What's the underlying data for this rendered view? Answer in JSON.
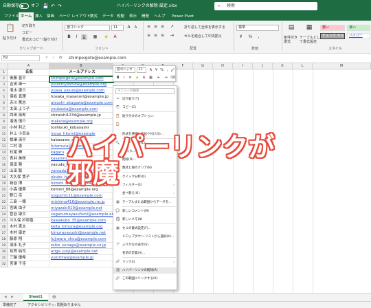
{
  "titlebar": {
    "autosave": "自動保存",
    "autosave_state": "オフ",
    "title": "ハイパーリンクの解除-設定.xlsx",
    "search_placeholder": "検索"
  },
  "tabs": [
    "ファイル",
    "ホーム",
    "挿入",
    "描画",
    "ページ レイアウト",
    "数式",
    "データ",
    "校閲",
    "表示",
    "開発",
    "ヘルプ",
    "Power Pivot"
  ],
  "active_tab": "ホーム",
  "ribbon": {
    "paste": "貼り付け",
    "cut": "切り取り",
    "copy": "コピー",
    "format_painter": "書式のコピー/貼り付け",
    "clipboard": "クリップボード",
    "font_name": "游ゴシック",
    "font_size": "11",
    "font": "フォント",
    "wrap_text": "折り返して全体を表示する",
    "merge": "セルを結合して中央揃え",
    "alignment": "配置",
    "number_format": "標準",
    "number": "数値",
    "conditional": "条件付き書式",
    "table_format": "テーブルとして書式設定",
    "style_bad": "悪い",
    "style_good": "良い",
    "style_check": "チェック セル",
    "style_link": "ハイパー",
    "styles": "スタイル",
    "bold": "B",
    "italic": "I",
    "underline": "U",
    "currency": "%",
    "comma": ","
  },
  "formula_bar": {
    "name_box": "B2",
    "fx": "fx",
    "value": "shimpeigoto@example.com"
  },
  "columns": [
    "A",
    "B",
    "C",
    "D",
    "E",
    "F",
    "G",
    "H",
    "I",
    "J",
    "K",
    "L",
    "M"
  ],
  "header_row": {
    "row": "1",
    "name": "氏名",
    "email": "メールアドレス"
  },
  "rows": [
    {
      "n": "2",
      "name": "後藤 晋平",
      "email": "shimpeigoto@example.com",
      "link": true
    },
    {
      "n": "3",
      "name": "吉田 雄一",
      "email": "yuuichiyoshida@example.org",
      "link": true
    },
    {
      "n": "4",
      "name": "清水 康介",
      "email": "yuasa_yasuo@example.com",
      "link": true
    },
    {
      "n": "5",
      "name": "保坂 真理",
      "email": "hosaka_masanori@example.jp",
      "link": false
    },
    {
      "n": "6",
      "name": "赤川 篤志",
      "email": "atsushi_akagawa@example.com",
      "link": true
    },
    {
      "n": "7",
      "name": "太田 よう子",
      "email": "youkoota@example.com",
      "link": true
    },
    {
      "n": "8",
      "name": "西田 拓郎",
      "email": "shiraishi1234@example.jp",
      "link": false
    },
    {
      "n": "9",
      "name": "湯浅 慎介",
      "email": "makuta@example.org",
      "link": true
    },
    {
      "n": "10",
      "name": "小林 利之",
      "email": "toshiyuki_kobayashi",
      "link": false
    },
    {
      "n": "11",
      "name": "井上 小百合",
      "email": "inoue_hitomi@example",
      "link": true
    },
    {
      "n": "12",
      "name": "相澤 清平",
      "email": "kabasawa_seiichi",
      "link": false
    },
    {
      "n": "13",
      "name": "二村 恵",
      "email": "futamura@example",
      "link": true
    },
    {
      "n": "14",
      "name": "杉尾 輝",
      "email": "kagaru",
      "link": true
    },
    {
      "n": "15",
      "name": "青井 美咲",
      "email": "kasahiro",
      "link": true
    },
    {
      "n": "16",
      "name": "保田 賢",
      "email": "yasuda_k",
      "link": false
    },
    {
      "n": "17",
      "name": "山田 聡",
      "email": "yamada1022@example.org",
      "link": true
    },
    {
      "n": "18",
      "name": "大久保 貴子",
      "email": "okubo_hideko@example.com",
      "link": true
    },
    {
      "n": "19",
      "name": "新谷 博",
      "email": "hiroshi_shintani@example.com",
      "link": true
    },
    {
      "n": "20",
      "name": "小森 優実",
      "email": "komori_88@example.org",
      "link": false
    },
    {
      "n": "21",
      "name": "野口 宗",
      "email": "noguchi111@example.com",
      "link": true
    },
    {
      "n": "22",
      "name": "三島 一穂",
      "email": "mishima416@example.ne.jp",
      "link": true
    },
    {
      "n": "23",
      "name": "宮嶋 由子",
      "email": "miyazaki919@example.net",
      "link": true
    },
    {
      "n": "24",
      "name": "菅谷 康文",
      "email": "suganumayasufumi@example.org",
      "link": true
    },
    {
      "n": "25",
      "name": "川久保 紗耶香",
      "email": "kawakubo_35@example.com",
      "link": true
    },
    {
      "n": "26",
      "name": "木村 恵太",
      "email": "keita_kimura@example.org",
      "link": true
    },
    {
      "n": "27",
      "name": "木村 康史",
      "email": "kimurayasushi@example.net",
      "link": true
    },
    {
      "n": "28",
      "name": "藤原 翔",
      "email": "fujiwara_shou@example.com",
      "link": true
    },
    {
      "n": "29",
      "name": "須永 礼子",
      "email": "reiko_sunaga@example.co.jp",
      "link": true
    },
    {
      "n": "30",
      "name": "有賀 純司",
      "email": "ariga_junji@example.net",
      "link": true
    },
    {
      "n": "31",
      "name": "三輪 優希",
      "email": "yukimiwa@example.jp",
      "link": true
    },
    {
      "n": "32",
      "name": "宮澤 千佳",
      "email": "",
      "link": false
    }
  ],
  "mini_toolbar": {
    "font": "游ゴシック",
    "size": "11",
    "bold": "B",
    "italic": "I",
    "percent": "%",
    "comma": ","
  },
  "context_menu": {
    "search_placeholder": "メニューの検索",
    "items": [
      {
        "label": "切り取り(T)",
        "icon": "✂",
        "arrow": false
      },
      {
        "label": "コピー(C)",
        "icon": "⎘",
        "arrow": false
      },
      {
        "label": "貼り付けのオプション:",
        "icon": "📋",
        "arrow": false
      },
      {
        "label": "",
        "icon": "📋",
        "arrow": false
      },
      {
        "label": "形式を選択して貼り付け(S)...",
        "icon": "",
        "arrow": false
      },
      {
        "label": "スマート検索(L)",
        "icon": "🔍",
        "arrow": false
      },
      {
        "label": "挿入(I)...",
        "icon": "",
        "arrow": false
      },
      {
        "label": "削除(D)...",
        "icon": "",
        "arrow": false
      },
      {
        "label": "数式と値のクリア(N)",
        "icon": "",
        "arrow": false
      },
      {
        "label": "クイック分析(Q)",
        "icon": "⚡",
        "arrow": false
      },
      {
        "label": "フィルター(E)",
        "icon": "",
        "arrow": true
      },
      {
        "label": "並べ替え(O)",
        "icon": "",
        "arrow": true
      },
      {
        "label": "テーブルまたは範囲からデータを...",
        "icon": "▦",
        "arrow": false
      },
      {
        "label": "新しいコメント(M)",
        "icon": "💬",
        "arrow": false
      },
      {
        "label": "新しいメモ(N)",
        "icon": "🗒",
        "arrow": false
      },
      {
        "label": "セルの書式設定(F)...",
        "icon": "▦",
        "arrow": false
      },
      {
        "label": "ドロップダウン リストから選択(K)...",
        "icon": "",
        "arrow": false
      },
      {
        "label": "ふりがなの表示(S)",
        "icon": "ア",
        "arrow": false
      },
      {
        "label": "名前の定義(A)...",
        "icon": "",
        "arrow": false
      },
      {
        "label": "リンク(I)",
        "icon": "🔗",
        "arrow": true
      },
      {
        "label": "ハイパーリンクの削除(R)",
        "icon": "⛓",
        "arrow": false
      },
      {
        "label": "この範囲にリンクする(K)",
        "icon": "🔗",
        "arrow": false
      }
    ]
  },
  "overlay": {
    "line1": "ハイパーリンクが",
    "line2": "邪魔",
    "color": "#e84b3c"
  },
  "sheet_tab": "Sheet1",
  "status": {
    "ready": "準備完了",
    "accessibility": "アクセシビリティ: 問題ありません"
  },
  "colors": {
    "excel_green": "#1e6c41",
    "link_blue": "#2b56c6"
  }
}
